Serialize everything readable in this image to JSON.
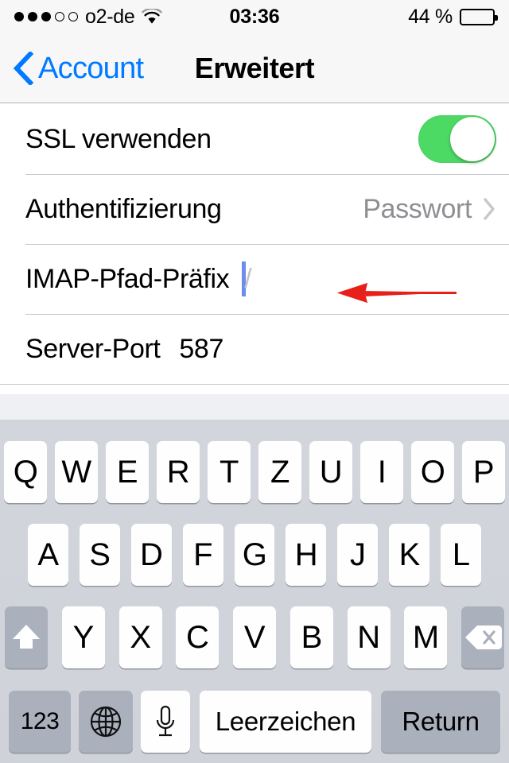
{
  "status_bar": {
    "signal_dots_filled": 3,
    "signal_dots_total": 5,
    "carrier": "o2-de",
    "wifi_icon": "wifi-icon",
    "time": "03:36",
    "battery_percent_label": "44 %",
    "battery_level": 44,
    "battery_icon": "battery-icon"
  },
  "nav_bar": {
    "back_icon": "chevron-left-icon",
    "back_label": "Account",
    "title": "Erweitert"
  },
  "settings": {
    "rows": [
      {
        "label": "SSL verwenden",
        "type": "toggle",
        "value": "on",
        "accent_color": "#4cd964"
      },
      {
        "label": "Authentifizierung",
        "type": "disclosure",
        "value": "Passwort",
        "chevron_icon": "chevron-right-icon"
      },
      {
        "label": "IMAP-Pfad-Präfix",
        "type": "textfield",
        "value": "",
        "placeholder": "/",
        "focused": true,
        "caret_color": "#6d8cf0"
      },
      {
        "label": "Server-Port",
        "type": "textfield",
        "value": "587",
        "placeholder": ""
      }
    ]
  },
  "annotation": {
    "arrow_icon": "red-arrow-left-icon",
    "color": "#e8201a",
    "points_to": "IMAP-Pfad-Präfix"
  },
  "keyboard": {
    "layout": "QWERTZ",
    "language": "German",
    "row1": [
      "Q",
      "W",
      "E",
      "R",
      "T",
      "Z",
      "U",
      "I",
      "O",
      "P"
    ],
    "row2": [
      "A",
      "S",
      "D",
      "F",
      "G",
      "H",
      "J",
      "K",
      "L"
    ],
    "row3": [
      "Y",
      "X",
      "C",
      "V",
      "B",
      "N",
      "M"
    ],
    "shift_icon": "shift-up-arrow-icon",
    "delete_icon": "delete-backspace-icon",
    "numeric_label": "123",
    "globe_icon": "globe-icon",
    "mic_icon": "microphone-icon",
    "space_label": "Leerzeichen",
    "return_label": "Return"
  }
}
